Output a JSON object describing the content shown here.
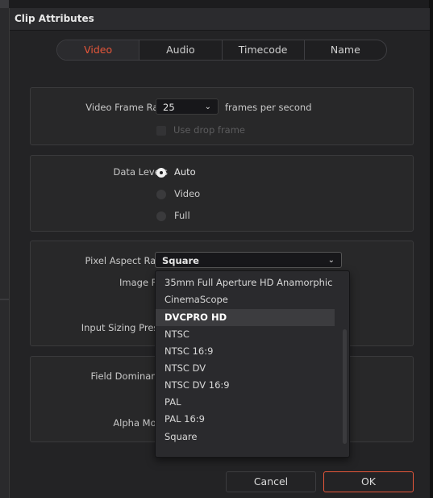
{
  "dialog": {
    "title": "Clip Attributes"
  },
  "tabs": [
    {
      "label": "Video",
      "active": true
    },
    {
      "label": "Audio",
      "active": false
    },
    {
      "label": "Timecode",
      "active": false
    },
    {
      "label": "Name",
      "active": false
    }
  ],
  "frame_rate": {
    "label": "Video Frame Rate",
    "value": "25",
    "unit": "frames per second",
    "drop_frame_label": "Use drop frame",
    "drop_frame_checked": false
  },
  "data_levels": {
    "label": "Data Levels",
    "options": [
      "Auto",
      "Video",
      "Full"
    ],
    "selected": "Auto"
  },
  "pixel_aspect": {
    "label": "Pixel Aspect Ratio",
    "value": "Square",
    "options": [
      "35mm Full Aperture HD Anamorphic",
      "CinemaScope",
      "DVCPRO HD",
      "NTSC",
      "NTSC 16:9",
      "NTSC DV",
      "NTSC DV 16:9",
      "PAL",
      "PAL 16:9",
      "Square"
    ],
    "highlighted": "DVCPRO HD"
  },
  "labels": {
    "image_flip": "Image Flip",
    "input_sizing": "Input Sizing Preset",
    "field_dominance": "Field Dominance",
    "alpha_mode": "Alpha Mode"
  },
  "buttons": {
    "cancel": "Cancel",
    "ok": "OK"
  },
  "colors": {
    "accent": "#e5563a",
    "background": "#232325",
    "panel": "#282829"
  }
}
